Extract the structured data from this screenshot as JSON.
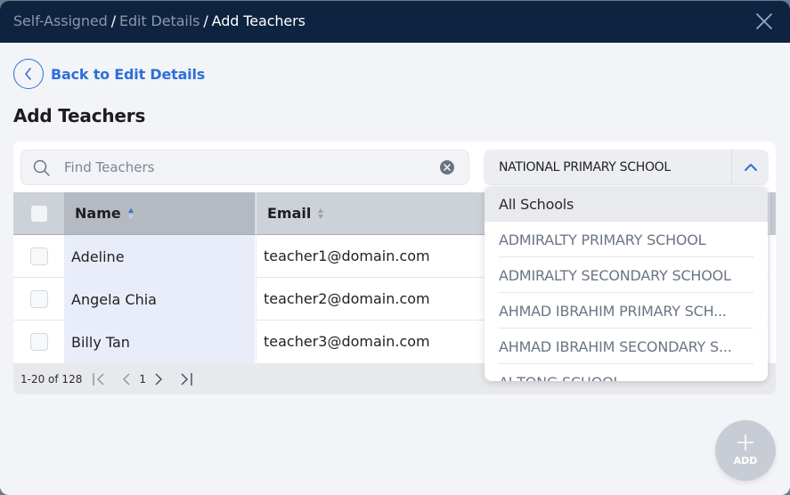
{
  "header": {
    "breadcrumb": [
      "Self-Assigned",
      "Edit Details",
      "Add Teachers"
    ],
    "separator": "/",
    "close_icon": "close-icon"
  },
  "back_link": {
    "label": "Back to Edit Details",
    "icon": "chevron-left-icon"
  },
  "page_title": "Add Teachers",
  "search": {
    "placeholder": "Find Teachers",
    "value": "",
    "icon": "search-icon",
    "clear_icon": "clear-circle-icon"
  },
  "school_select": {
    "value": "NATIONAL PRIMARY SCHOOL",
    "toggle_icon": "chevron-up-icon",
    "open": true,
    "options": [
      "All Schools",
      "ADMIRALTY PRIMARY SCHOOL",
      "ADMIRALTY SECONDARY SCHOOL",
      "AHMAD IBRAHIM PRIMARY SCH...",
      "AHMAD IBRAHIM SECONDARY S...",
      "AI TONG SCHOOL"
    ],
    "highlighted_index": 0
  },
  "table": {
    "columns": [
      {
        "label": "Name",
        "sort": "ascending"
      },
      {
        "label": "Email",
        "sort": "none"
      }
    ],
    "rows": [
      {
        "name": "Adeline",
        "email": "teacher1@domain.com",
        "checked": false
      },
      {
        "name": "Angela Chia",
        "email": "teacher2@domain.com",
        "checked": false
      },
      {
        "name": "Billy Tan",
        "email": "teacher3@domain.com",
        "checked": false
      }
    ]
  },
  "pagination": {
    "range": "1-20 of 128",
    "current_page": "1"
  },
  "add_button": {
    "label": "ADD",
    "icon": "plus-icon"
  },
  "colors": {
    "header_bg": "#0d2340",
    "accent": "#2f6fd8",
    "page_bg": "#f3f4f8",
    "name_col_highlight": "#e9edf9",
    "fab_bg": "#c8ccd4"
  }
}
